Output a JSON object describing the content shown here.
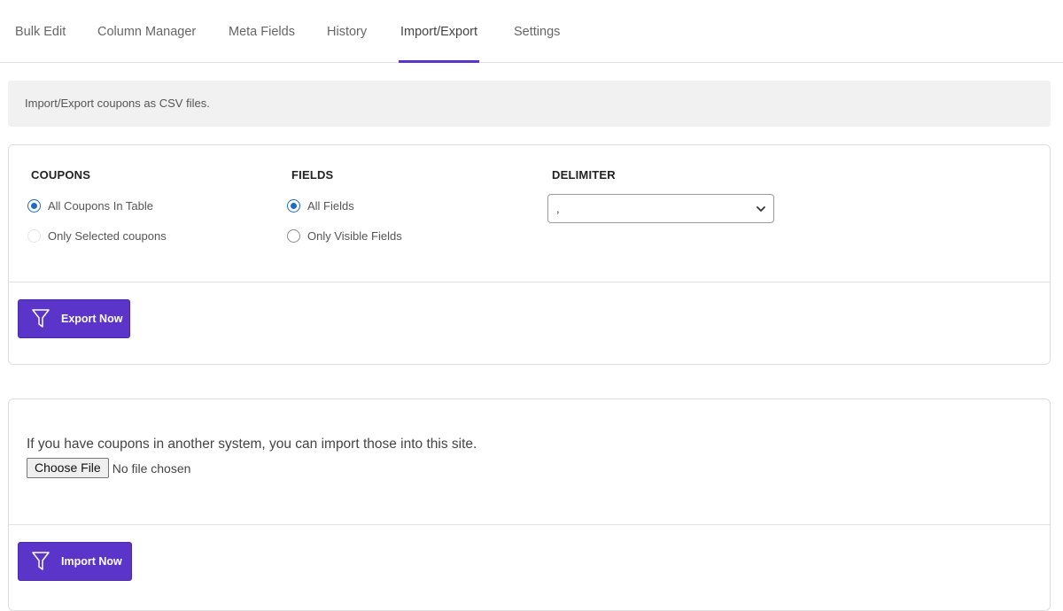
{
  "tabs": [
    {
      "label": "Bulk Edit"
    },
    {
      "label": "Column Manager"
    },
    {
      "label": "Meta Fields"
    },
    {
      "label": "History"
    },
    {
      "label": "Import/Export",
      "active": true
    },
    {
      "label": "Settings"
    }
  ],
  "notice": "Import/Export coupons as CSV files.",
  "export": {
    "coupons": {
      "title": "COUPONS",
      "options": [
        "All Coupons In Table",
        "Only Selected coupons"
      ],
      "selected": "All Coupons In Table"
    },
    "fields": {
      "title": "FIELDS",
      "options": [
        "All Fields",
        "Only Visible Fields"
      ],
      "selected": "All Fields"
    },
    "delimiter": {
      "title": "DELIMITER",
      "value": ","
    },
    "button_label": "Export Now",
    "button_icon": "filter-icon"
  },
  "import": {
    "description": "If you have coupons in another system, you can import those into this site.",
    "file_button": "Choose File",
    "file_status": "No file chosen",
    "button_label": "Import Now",
    "button_icon": "filter-icon"
  },
  "colors": {
    "accent": "#5b34c9",
    "radio_checked": "#1e6bc7",
    "notice_bg": "#f1f1f1"
  }
}
